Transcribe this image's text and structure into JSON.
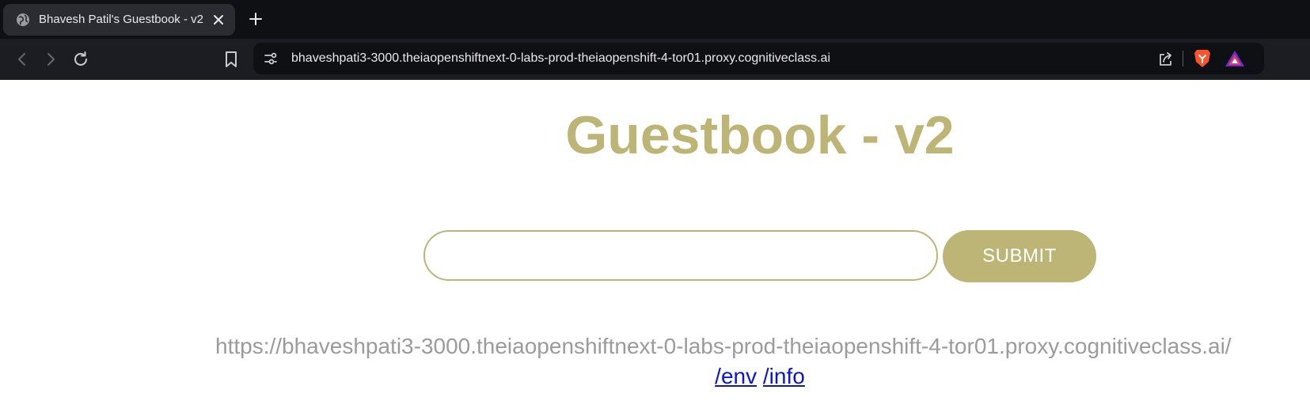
{
  "browser": {
    "tab": {
      "title": "Bhavesh Patil's Guestbook - v2"
    },
    "address_bar": {
      "url": "bhaveshpati3-3000.theiaopenshiftnext-0-labs-prod-theiaopenshift-4-tor01.proxy.cognitiveclass.ai"
    },
    "colors": {
      "tabbar": "#0f1014",
      "toolbar": "#1c1d22",
      "tab_active": "#2b2c31"
    }
  },
  "page": {
    "title": "Guestbook - v2",
    "entry_input": {
      "value": "",
      "placeholder": ""
    },
    "submit_label": "SUBMIT",
    "host_url": "https://bhaveshpati3-3000.theiaopenshiftnext-0-labs-prod-theiaopenshift-4-tor01.proxy.cognitiveclass.ai/",
    "links": {
      "env": "/env",
      "info": "/info"
    },
    "colors": {
      "accent": "#bcb576",
      "link": "#0a16d4",
      "muted_text": "#9b9b9b"
    }
  }
}
